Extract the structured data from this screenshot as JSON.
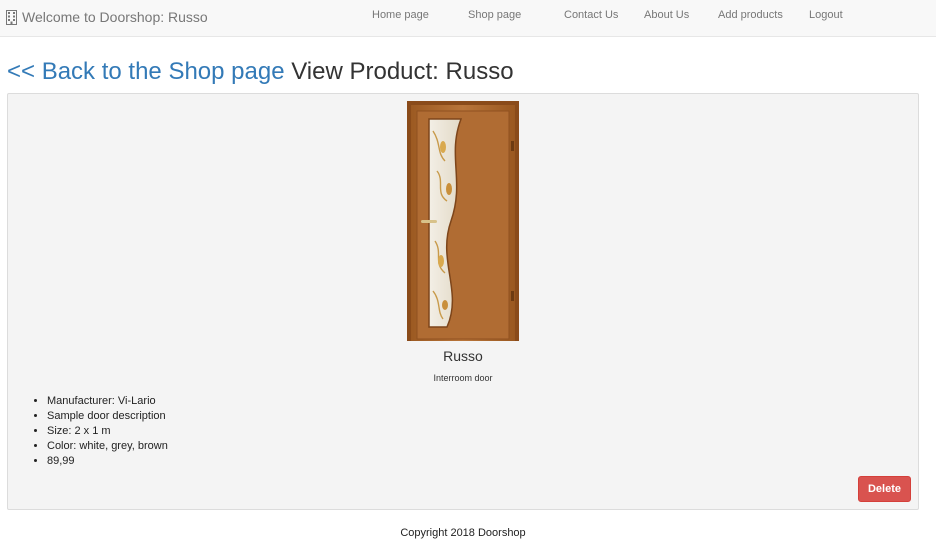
{
  "navbar": {
    "brand": "Welcome to Doorshop: Russo",
    "brand_icon": "building-icon",
    "links": [
      "Home page",
      "Shop page",
      "Contact Us",
      "About Us",
      "Add products",
      "Logout"
    ]
  },
  "heading": {
    "back_link": "<< Back to the Shop page",
    "title": "View Product: Russo"
  },
  "product": {
    "name": "Russo",
    "category": "Interroom door",
    "details": [
      "Manufacturer: Vi-Lario",
      "Sample door description",
      "Size: 2 x 1 m",
      "Color: white, grey, brown",
      "89,99"
    ],
    "delete_label": "Delete"
  },
  "footer": {
    "copyright": "Copyright 2018 Doorshop"
  },
  "colors": {
    "link": "#337ab7",
    "danger": "#d9534f",
    "panel_bg": "#f4f4f4",
    "navbar_bg": "#f8f8f8"
  }
}
